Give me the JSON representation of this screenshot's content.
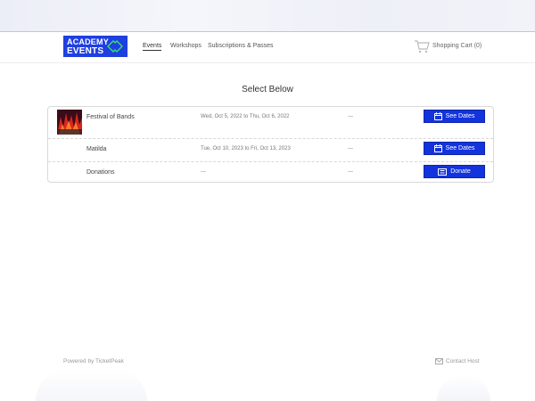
{
  "header": {
    "logo_line1": "ACADEMY",
    "logo_line2": "EVENTS",
    "nav": [
      "Events",
      "Workshops",
      "Subscriptions & Passes"
    ],
    "cart_label": "Shopping Cart (0)"
  },
  "main": {
    "title": "Select Below",
    "rows": [
      {
        "name": "Festival of Bands",
        "dates": "Wed, Oct 5, 2022 to Thu, Oct 6, 2022",
        "extra": "---",
        "button": "See Dates",
        "button_icon": "calendar-icon"
      },
      {
        "name": "Matilda",
        "dates": "Tue, Oct 10, 2023 to Fri, Oct 13, 2023",
        "extra": "---",
        "button": "See Dates",
        "button_icon": "calendar-icon"
      },
      {
        "name": "Donations",
        "dates": "---",
        "extra": "---",
        "button": "Donate",
        "button_icon": "donate-ticket-icon"
      }
    ]
  },
  "footer": {
    "powered_by": "Powered by TicketPeak",
    "contact": "Contact Host"
  },
  "colors": {
    "brand": "#1f3fe0",
    "button": "#1333dc"
  }
}
